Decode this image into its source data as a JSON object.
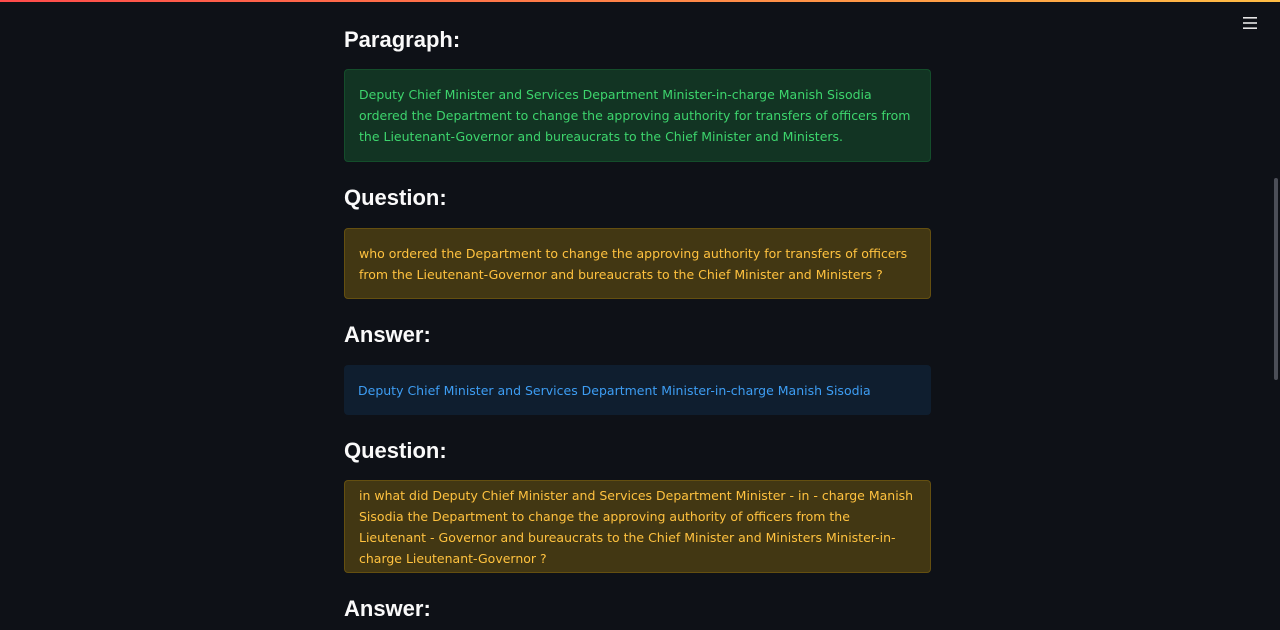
{
  "sections": [
    {
      "heading": "Paragraph:",
      "text": "Deputy Chief Minister and Services Department Minister-in-charge Manish Sisodia ordered the Department to change the approving authority for transfers of officers from the Lieutenant-Governor and bureaucrats to the Chief Minister and Ministers.",
      "kind": "success"
    },
    {
      "heading": "Question:",
      "text": "who ordered the Department to change the approving authority for transfers of officers from the Lieutenant-Governor and bureaucrats to the Chief Minister and Ministers ?",
      "kind": "warning"
    },
    {
      "heading": "Answer:",
      "text": "Deputy Chief Minister and Services Department Minister-in-charge Manish Sisodia",
      "kind": "info"
    },
    {
      "heading": "Question:",
      "text": "in what did Deputy Chief Minister and Services Department Minister - in - charge Manish Sisodia the Department to change the approving authority of officers from the Lieutenant - Governor and bureaucrats to the Chief Minister and Ministers Minister-in-charge Lieutenant-Governor ?",
      "kind": "warning"
    },
    {
      "heading": "Answer:"
    }
  ],
  "icons": {
    "menu": "hamburger-menu-icon"
  },
  "colors": {
    "background": "#0e1117",
    "success_text": "#3dd56d",
    "warning_text": "#ffc23f",
    "info_text": "#3d9df3",
    "heading": "#fafafa"
  }
}
